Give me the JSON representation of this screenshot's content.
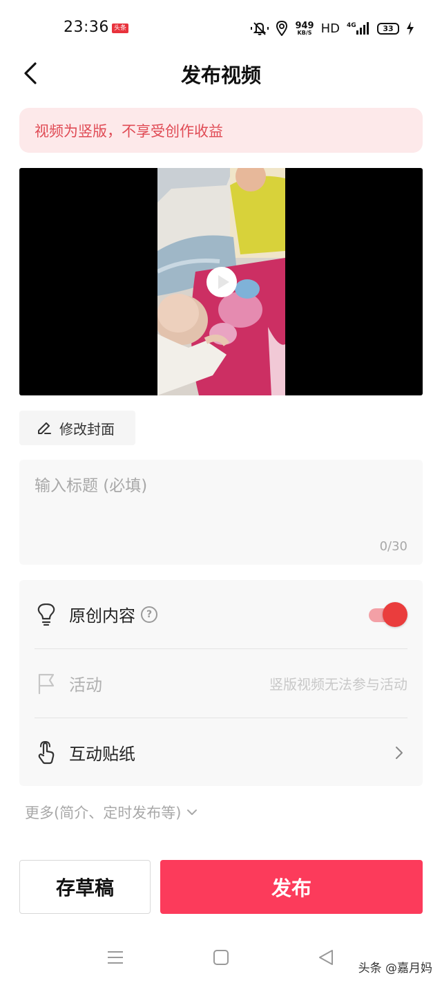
{
  "status_bar": {
    "time": "23:36",
    "app_badge": "头条",
    "net_speed": "949",
    "net_unit": "KB/S",
    "hd": "HD",
    "network": "4G",
    "battery": "33"
  },
  "header": {
    "title": "发布视频"
  },
  "warning": {
    "text": "视频为竖版，不享受创作收益"
  },
  "cover": {
    "edit_label": "修改封面"
  },
  "title_input": {
    "placeholder": "输入标题 (必填)",
    "value": "",
    "counter": "0/30"
  },
  "options": {
    "original": {
      "label": "原创内容",
      "help": "?",
      "enabled": true
    },
    "activity": {
      "label": "活动",
      "hint": "竖版视频无法参与活动"
    },
    "sticker": {
      "label": "互动贴纸"
    }
  },
  "more": {
    "label": "更多(简介、定时发布等)"
  },
  "actions": {
    "save_draft": "存草稿",
    "publish": "发布"
  },
  "watermark": "头条 @嘉月妈",
  "colors": {
    "accent": "#fc3b5b",
    "warning_bg": "#fde9ea",
    "warning_text": "#e04b55",
    "toggle_on": "#ea3d3d"
  }
}
